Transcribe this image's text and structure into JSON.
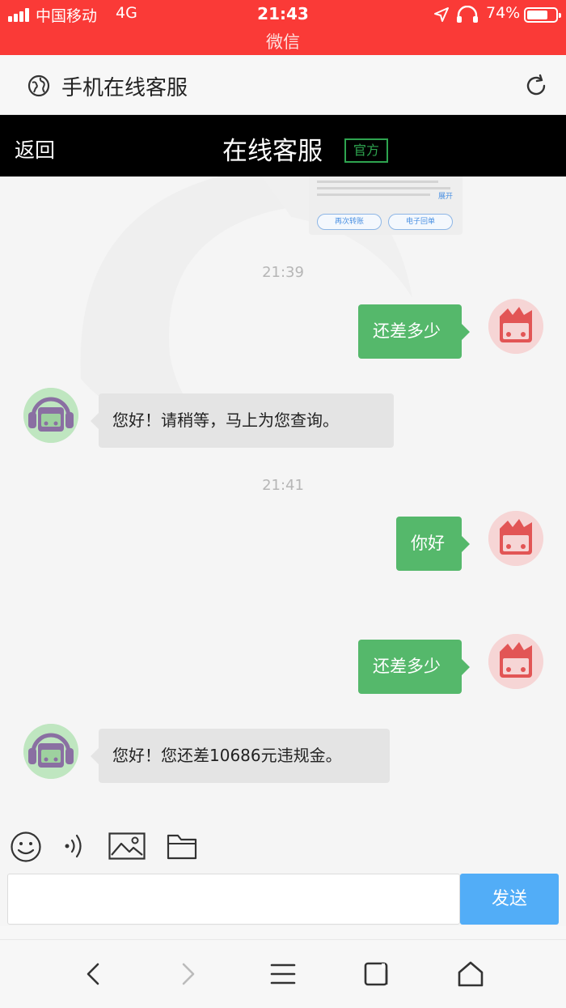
{
  "status_bar": {
    "carrier": "中国移动",
    "network": "4G",
    "time": "21:43",
    "battery_pct": "74%",
    "battery_level": 0.74,
    "app": "微信",
    "icons": [
      "signal-icon",
      "location-arrow-icon",
      "headphones-icon",
      "battery-icon"
    ]
  },
  "browser": {
    "title": "手机在线客服",
    "icons": [
      "globe-icon",
      "refresh-icon"
    ]
  },
  "header": {
    "back_label": "返回",
    "title": "在线客服",
    "badge": "官方"
  },
  "thumbnail": {
    "more_label": "展开",
    "buttons": [
      "再次转账",
      "电子回单"
    ]
  },
  "messages": [
    {
      "type": "time",
      "text": "21:39"
    },
    {
      "type": "out",
      "text": "还差多少"
    },
    {
      "type": "in",
      "text": "您好！请稍等，马上为您查询。"
    },
    {
      "type": "time",
      "text": "21:41"
    },
    {
      "type": "out",
      "text": "你好"
    },
    {
      "type": "out",
      "text": "还差多少"
    },
    {
      "type": "in",
      "text": "您好！您还差10686元违规金。"
    }
  ],
  "toolbar": {
    "icons": [
      "emoji-icon",
      "voice-icon",
      "image-icon",
      "folder-icon"
    ]
  },
  "composer": {
    "input_value": "",
    "send_label": "发送"
  },
  "nav": {
    "icons": [
      "back-arrow-icon",
      "forward-arrow-icon",
      "menu-icon",
      "tabs-icon",
      "home-icon"
    ]
  },
  "colors": {
    "status_bar": "#fa3a37",
    "header": "#000000",
    "badge": "#2ea44f",
    "outgoing_bubble": "#55b86b",
    "incoming_bubble": "#e4e4e4",
    "send_button": "#52adf7"
  }
}
